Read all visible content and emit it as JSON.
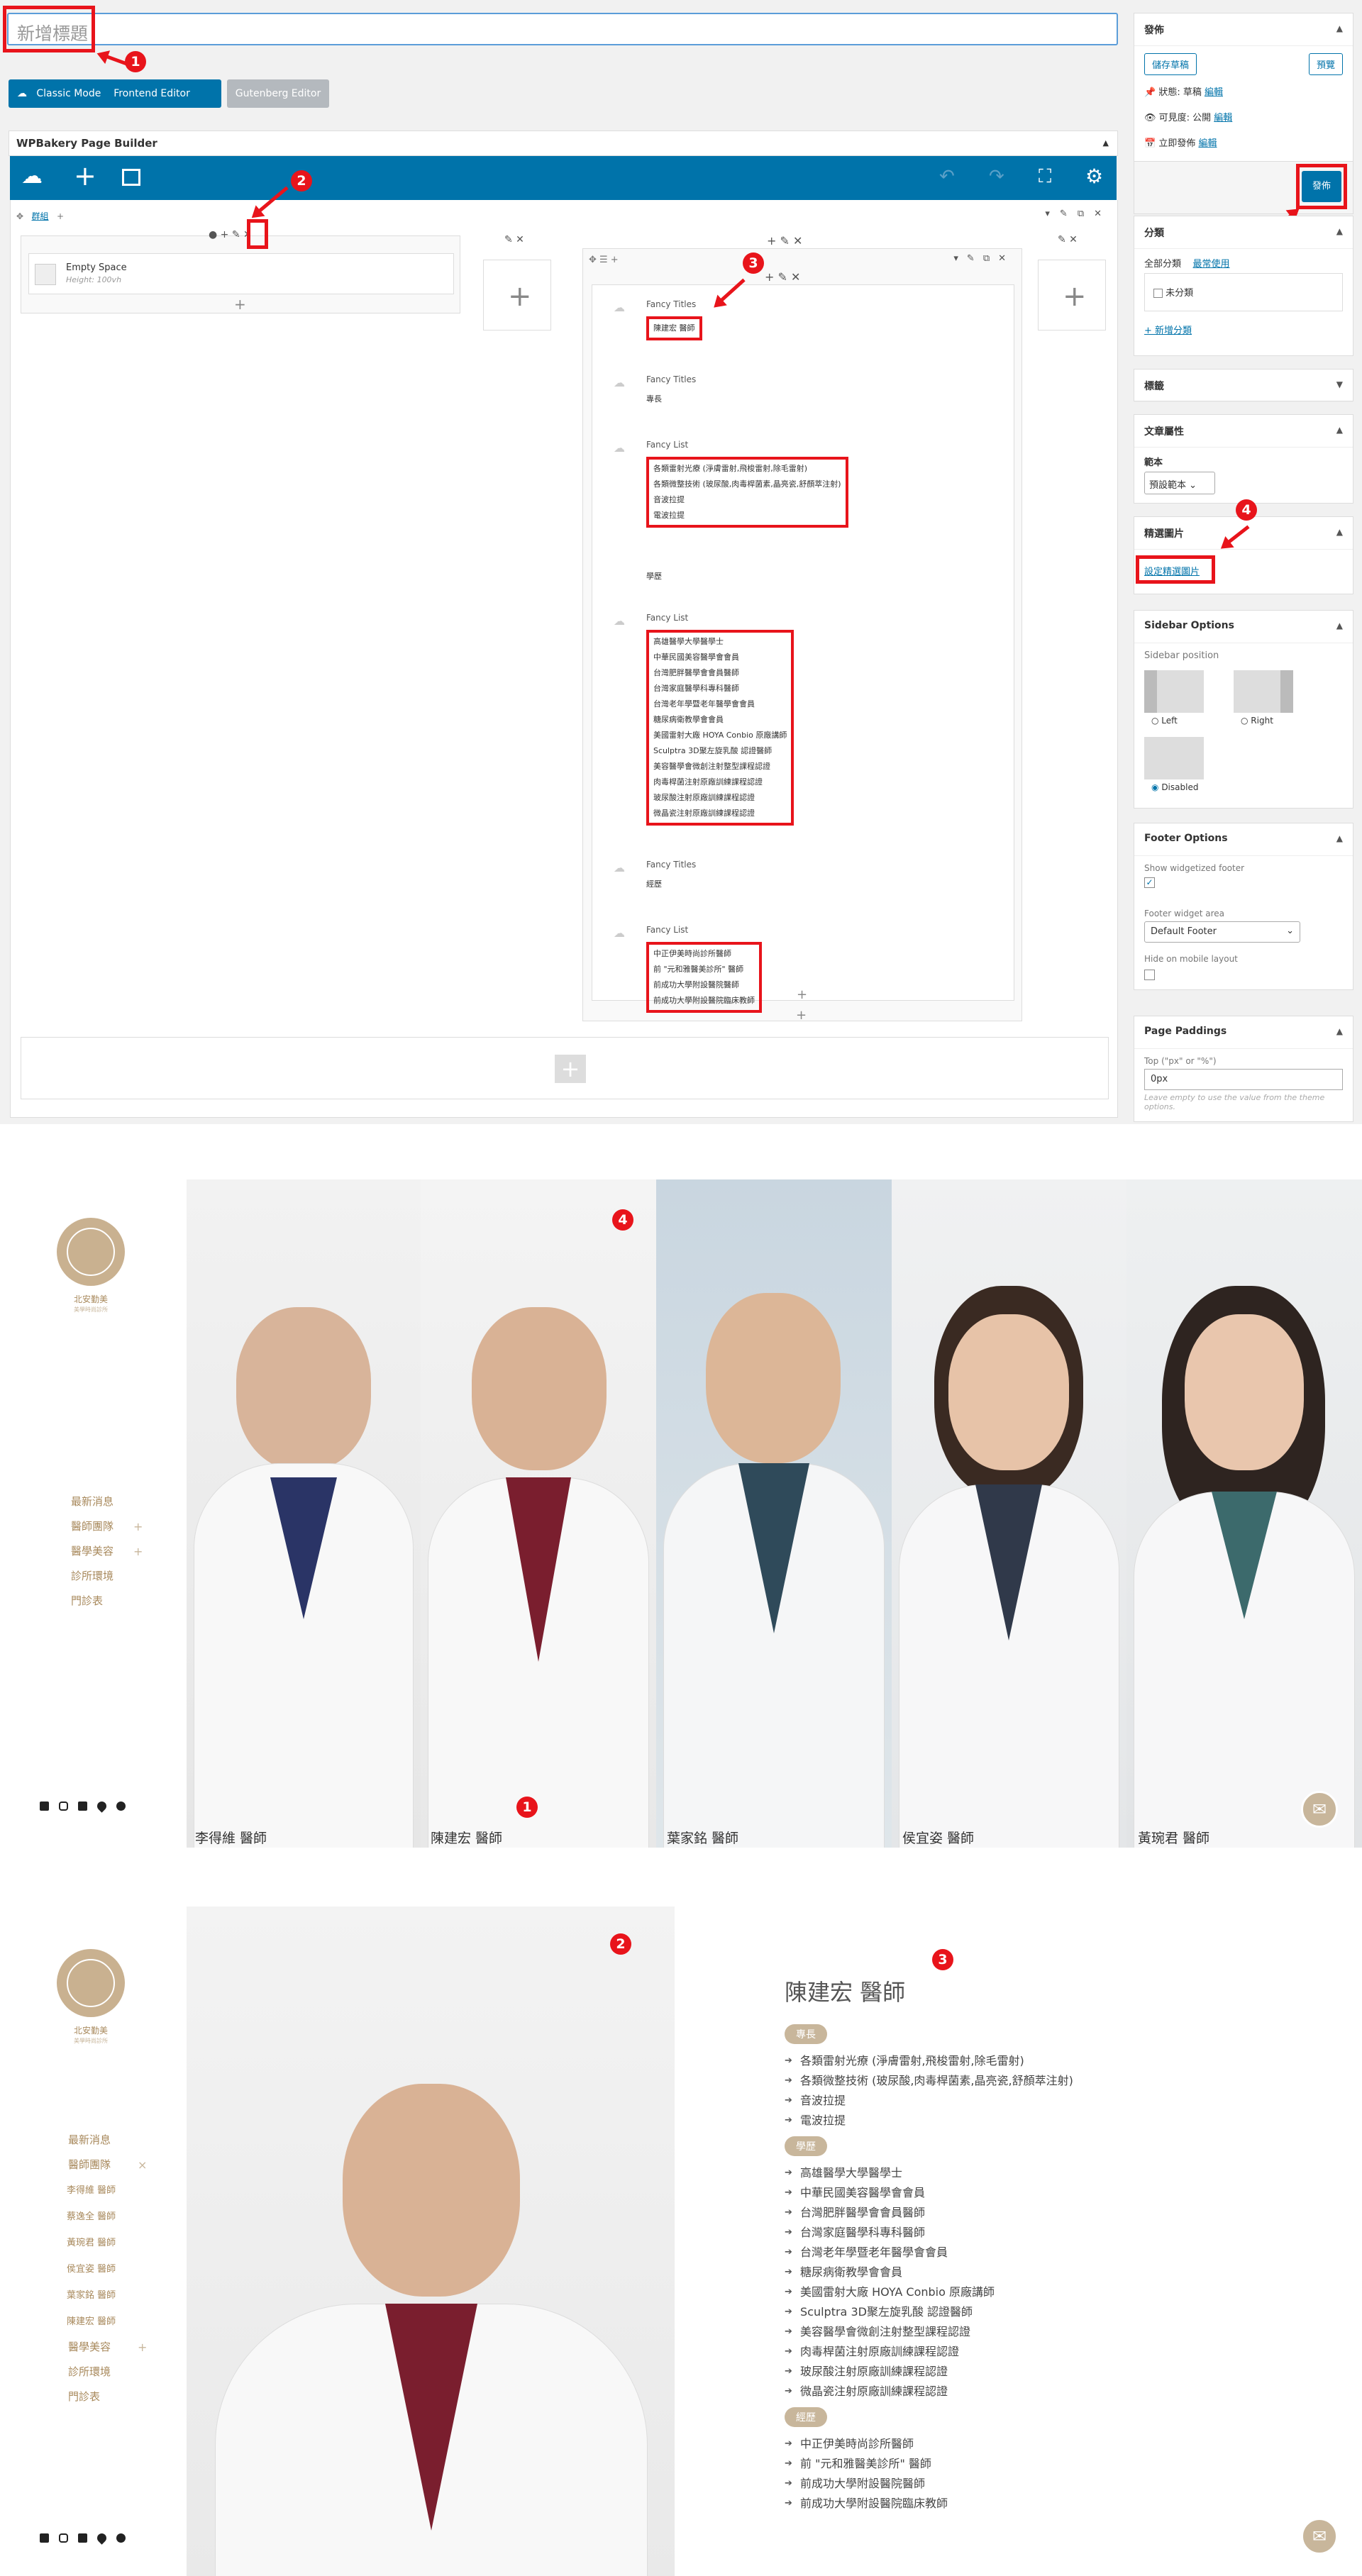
{
  "editor": {
    "title_placeholder": "新增標題",
    "mode_buttons": {
      "classic": "Classic Mode",
      "frontend": "Frontend Editor",
      "gutenberg": "Gutenberg Editor"
    },
    "builder_title": "WPBakery Page Builder",
    "tabs_label": "群組",
    "empty_space": {
      "label": "Empty Space",
      "height": "Height: 100vh"
    },
    "column_elements": [
      {
        "label": "Fancy Titles",
        "lines": [
          "陳建宏 醫師"
        ]
      },
      {
        "label": "Fancy Titles",
        "lines": [
          "專長"
        ]
      },
      {
        "label": "Fancy List",
        "lines": [
          "各類雷射光療 (淨膚雷射,飛梭雷射,除毛雷射)",
          "各類微整技術 (玻尿酸,肉毒桿菌素,晶亮瓷,舒顏萃注射)",
          "音波拉提",
          "電波拉提"
        ]
      },
      {
        "label": "",
        "lines": [
          "學歷"
        ]
      },
      {
        "label": "Fancy List",
        "lines": [
          "高雄醫學大學醫學士",
          "中華民國美容醫學會會員",
          "台灣肥胖醫學會會員醫師",
          "台灣家庭醫學科專科醫師",
          "台灣老年學暨老年醫學會會員",
          "糖尿病衛教學會會員",
          "美國雷射大廠 HOYA Conbio 原廠講師",
          "Sculptra 3D聚左旋乳酸 認證醫師",
          "美容醫學會微創注射整型課程認證",
          "肉毒桿菌注射原廠訓練課程認證",
          "玻尿酸注射原廠訓練課程認證",
          "微晶瓷注射原廠訓練課程認證"
        ]
      },
      {
        "label": "Fancy Titles",
        "lines": [
          "經歷"
        ]
      },
      {
        "label": "Fancy List",
        "lines": [
          "中正伊美時尚診所醫師",
          "前 \"元和雅醫美診所\" 醫師",
          "前成功大學附設醫院醫師",
          "前成功大學附設醫院臨床教師"
        ]
      }
    ]
  },
  "sidebar": {
    "publish": {
      "title": "發佈",
      "save_draft": "儲存草稿",
      "preview": "預覽",
      "status": "狀態: 草稿",
      "visibility": "可見度: 公開",
      "schedule": "立即發佈",
      "edit": "編輯",
      "publish_btn": "發佈"
    },
    "categories": {
      "title": "分類",
      "tab_all": "全部分類",
      "tab_common": "最常使用",
      "item": "未分類",
      "add": "+ 新增分類"
    },
    "tags": {
      "title": "標籤"
    },
    "attributes": {
      "title": "文章屬性",
      "template_label": "範本",
      "template_value": "預設範本"
    },
    "featured": {
      "title": "精選圖片",
      "link": "設定精選圖片"
    },
    "sidebar_options": {
      "title": "Sidebar Options",
      "position": "Sidebar position",
      "left": "Left",
      "right": "Right",
      "disabled": "Disabled"
    },
    "footer_options": {
      "title": "Footer Options",
      "widgetized": "Show widgetized footer",
      "widget_area_label": "Footer widget area",
      "widget_area_value": "Default Footer",
      "hide_mobile": "Hide on mobile layout"
    },
    "paddings": {
      "title": "Page Paddings",
      "top_label": "Top (\"px\" or \"%\")",
      "top_value": "0px",
      "hint": "Leave empty to use the value from the theme options."
    }
  },
  "annotations": [
    "1",
    "2",
    "3",
    "4"
  ],
  "site": {
    "logo_text": "北安勤美",
    "logo_sub": "美學時尚診所",
    "nav1": [
      "最新消息",
      "醫師團隊",
      "醫學美容",
      "診所環境",
      "門診表"
    ],
    "nav2": [
      "最新消息",
      "醫師團隊",
      "李得維 醫師",
      "蔡逸全 醫師",
      "黃琬君 醫師",
      "侯宜姿 醫師",
      "葉家銘 醫師",
      "陳建宏 醫師",
      "醫學美容",
      "診所環境",
      "門診表"
    ],
    "doctors": [
      "李得維 醫師",
      "陳建宏 醫師",
      "葉家銘 醫師",
      "侯宜姿 醫師",
      "黃琬君 醫師"
    ],
    "detail": {
      "name": "陳建宏 醫師",
      "tag1": "專長",
      "list1": [
        "各類雷射光療 (淨膚雷射,飛梭雷射,除毛雷射)",
        "各類微整技術 (玻尿酸,肉毒桿菌素,晶亮瓷,舒顏萃注射)",
        "音波拉提",
        "電波拉提"
      ],
      "tag2": "學歷",
      "list2": [
        "高雄醫學大學醫學士",
        "中華民國美容醫學會會員",
        "台灣肥胖醫學會會員醫師",
        "台灣家庭醫學科專科醫師",
        "台灣老年學暨老年醫學會會員",
        "糖尿病衛教學會會員",
        "美國雷射大廠 HOYA Conbio 原廠講師",
        "Sculptra 3D聚左旋乳酸 認證醫師",
        "美容醫學會微創注射整型課程認證",
        "肉毒桿菌注射原廠訓練課程認證",
        "玻尿酸注射原廠訓練課程認證",
        "微晶瓷注射原廠訓練課程認證"
      ],
      "tag3": "經歷",
      "list3": [
        "中正伊美時尚診所醫師",
        "前 \"元和雅醫美診所\" 醫師",
        "前成功大學附設醫院醫師",
        "前成功大學附設醫院臨床教師"
      ]
    }
  },
  "colors": {
    "wp_blue": "#0073aa",
    "annotation_red": "#e8141b",
    "brand_gold": "#a8895c",
    "tag_beige": "#c8b69b"
  }
}
